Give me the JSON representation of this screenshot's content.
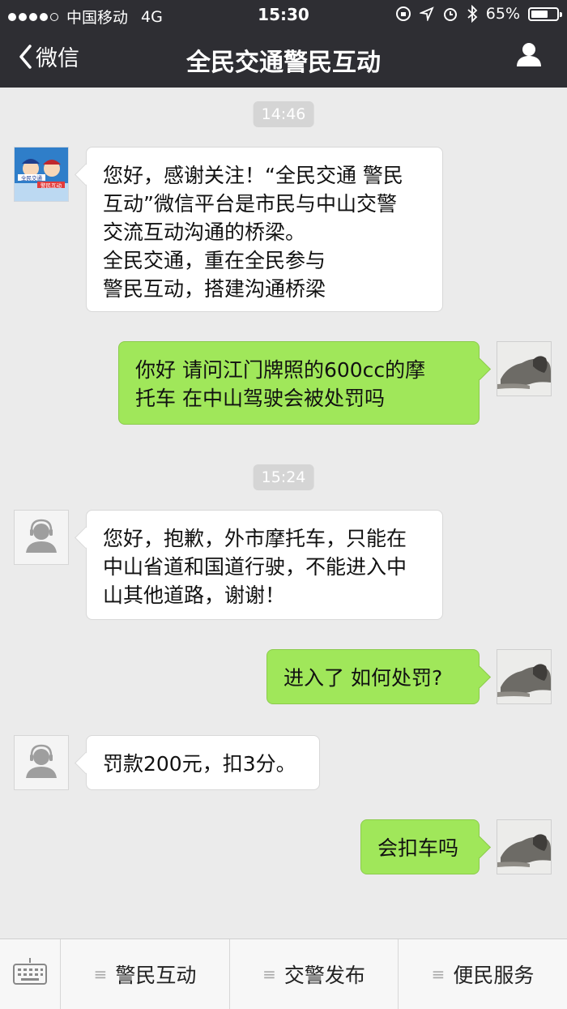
{
  "status_bar": {
    "carrier": "中国移动",
    "network": "4G",
    "time": "15:30",
    "battery": "65%",
    "battery_level": 0.65
  },
  "nav": {
    "back_label": "微信",
    "title": "全民交通警民互动"
  },
  "avatar_logo": {
    "line1": "全民交通",
    "line2": "警民互动"
  },
  "chat": {
    "timestamps": [
      "14:46",
      "15:24"
    ],
    "messages": [
      {
        "from": "in",
        "avatar": "logo",
        "lines": [
          "您好，感谢关注！“全民交通 警民",
          "互动”微信平台是市民与中山交警",
          "交流互动沟通的桥梁。",
          "全民交通，重在全民参与",
          "警民互动，搭建沟通桥梁"
        ]
      },
      {
        "from": "out",
        "lines": [
          "你好 请问江门牌照的600cc的摩",
          "托车 在中山驾驶会被处罚吗"
        ]
      },
      {
        "from": "in",
        "avatar": "bot",
        "lines": [
          "您好，抱歉，外市摩托车，只能在",
          "中山省道和国道行驶，不能进入中",
          "山其他道路，谢谢！"
        ]
      },
      {
        "from": "out",
        "lines": [
          "进入了 如何处罚?"
        ]
      },
      {
        "from": "in",
        "avatar": "bot",
        "lines": [
          "罚款200元，扣3分。"
        ]
      },
      {
        "from": "out",
        "lines": [
          "会扣车吗"
        ]
      }
    ]
  },
  "bottom_menu": {
    "items": [
      "警民互动",
      "交警发布",
      "便民服务"
    ]
  }
}
